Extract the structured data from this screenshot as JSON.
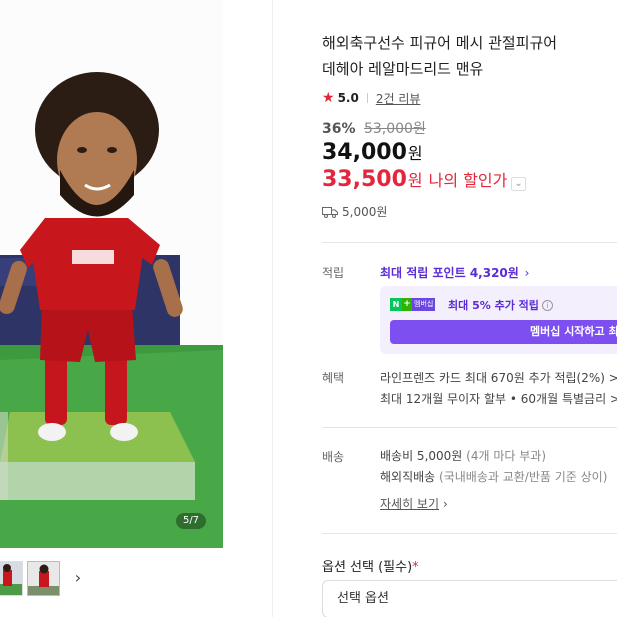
{
  "gallery": {
    "counter": "5/7",
    "next_icon": "chevron-right-icon"
  },
  "product": {
    "title_line1": "해외축구선수 피규어 메시 관절피규어 ",
    "title_line2": "데헤아 레알마드리드 맨유",
    "rating": "5.0",
    "review_count": "2건 리뷰",
    "discount_rate": "36%",
    "original_price": "53,000원",
    "price": "34,000",
    "price_unit": "원",
    "my_price": "33,500",
    "my_price_unit": "원",
    "my_price_label": "나의 할인가",
    "shipping_fee": "5,000원"
  },
  "points": {
    "label": "적립",
    "max_point": "최대 적립 포인트 4,320원",
    "badge_n": "N",
    "badge_plus": "+",
    "badge_member": "멤버십",
    "member_text": "최대 5% 추가 적립",
    "member_button": "멤버십 시작하고 최"
  },
  "benefits": {
    "label": "혜택",
    "line1": "라인프렌즈 카드 최대 670원 추가 적립(2%) >",
    "line2": "최대 12개월 무이자 할부 • 60개월 특별금리 >"
  },
  "delivery": {
    "label": "배송",
    "fee": "배송비 5,000원",
    "fee_note": "(4개 마다 부과)",
    "overseas": "해외직배송",
    "overseas_note": "(국내배송과 교환/반품 기준 상이)",
    "detail_link": "자세히 보기"
  },
  "options": {
    "title": "옵션 선택 (필수)",
    "required_mark": "*",
    "select_placeholder": "선택 옵션"
  },
  "colors": {
    "accent_red": "#e3263b",
    "membership_purple": "#7d4ef0",
    "naver_green": "#03c75a"
  }
}
